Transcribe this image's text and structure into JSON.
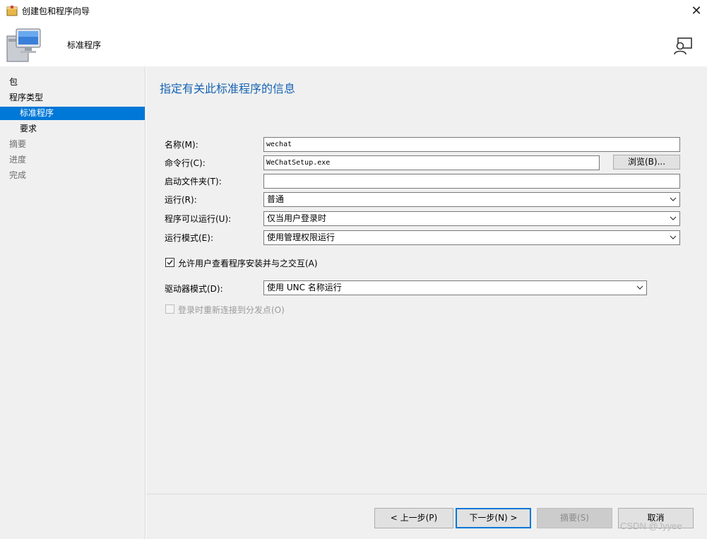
{
  "window": {
    "title": "创建包和程序向导",
    "close_glyph": "✕"
  },
  "header": {
    "page_name": "标准程序"
  },
  "sidebar": {
    "items": [
      {
        "label": "包"
      },
      {
        "label": "程序类型"
      },
      {
        "label": "标准程序"
      },
      {
        "label": "要求"
      },
      {
        "label": "摘要"
      },
      {
        "label": "进度"
      },
      {
        "label": "完成"
      }
    ],
    "selected": "标准程序"
  },
  "main": {
    "heading": "指定有关此标准程序的信息",
    "name_label": "名称(M):",
    "name_value": "wechat",
    "cmdline_label": "命令行(C):",
    "cmdline_value": "WeChatSetup.exe",
    "browse_label": "浏览(B)...",
    "startdir_label": "启动文件夹(T):",
    "startdir_value": "",
    "run_label": "运行(R):",
    "run_value": "普通",
    "canrun_label": "程序可以运行(U):",
    "canrun_value": "仅当用户登录时",
    "runmode_label": "运行模式(E):",
    "runmode_value": "使用管理权限运行",
    "allow_interact_label": "允许用户查看程序安装并与之交互(A)",
    "allow_interact_checked": true,
    "drivemode_label": "驱动器模式(D):",
    "drivemode_value": "使用 UNC 名称运行",
    "reconnect_label": "登录时重新连接到分发点(O)",
    "reconnect_checked": false
  },
  "footer": {
    "back_label": "< 上一步(P)",
    "next_label": "下一步(N) >",
    "summary_label": "摘要(S)",
    "cancel_label": "取消"
  },
  "watermark": "CSDN @Jyyee",
  "colors": {
    "accent": "#0078d7",
    "heading": "#1764b4",
    "panel": "#f0f0f0"
  }
}
